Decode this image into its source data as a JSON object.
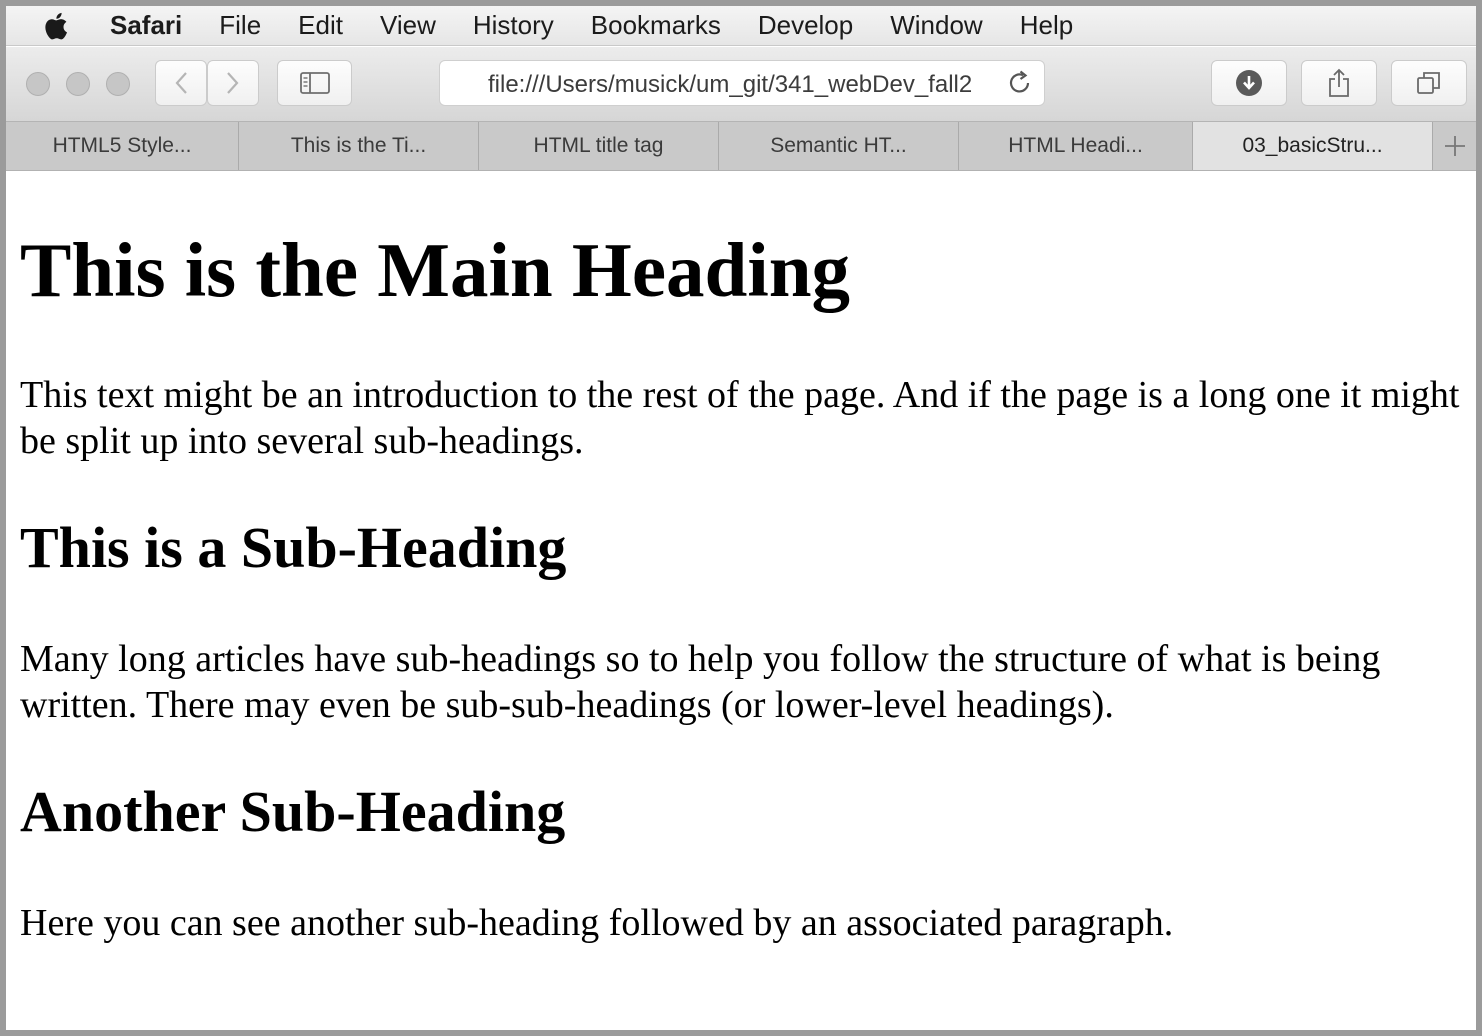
{
  "menubar": {
    "app": "Safari",
    "items": [
      "File",
      "Edit",
      "View",
      "History",
      "Bookmarks",
      "Develop",
      "Window",
      "Help"
    ]
  },
  "toolbar": {
    "address": "file:///Users/musick/um_git/341_webDev_fall2"
  },
  "tabs": [
    {
      "label": "HTML5 Style..."
    },
    {
      "label": "This is the Ti..."
    },
    {
      "label": "HTML title tag"
    },
    {
      "label": "Semantic HT..."
    },
    {
      "label": "HTML Headi..."
    },
    {
      "label": "03_basicStru..."
    }
  ],
  "page": {
    "h1": "This is the Main Heading",
    "p1": "This text might be an introduction to the rest of the page. And if the page is a long one it might be split up into several sub-headings.",
    "h2a": "This is a Sub-Heading",
    "p2": "Many long articles have sub-headings so to help you follow the structure of what is being written. There may even be sub-sub-headings (or lower-level headings).",
    "h2b": "Another Sub-Heading",
    "p3": "Here you can see another sub-heading followed by an associated paragraph."
  }
}
